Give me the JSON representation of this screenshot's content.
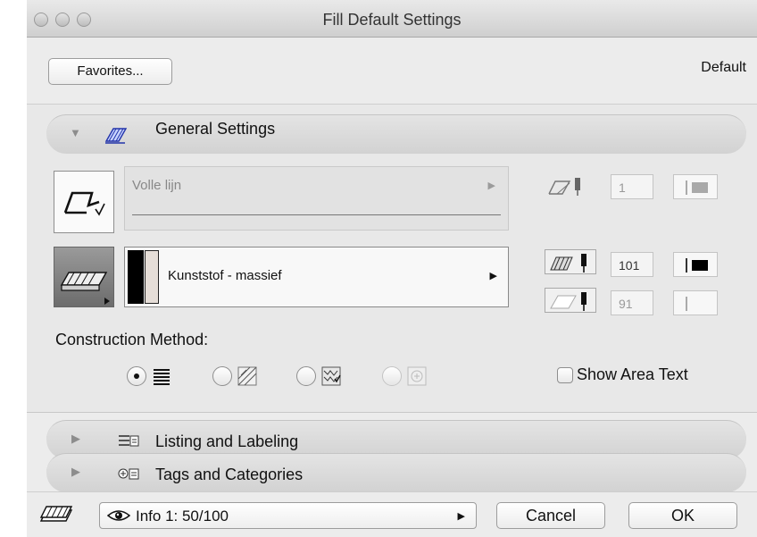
{
  "window": {
    "title": "Fill Default Settings"
  },
  "header": {
    "favorites_label": "Favorites...",
    "default_label": "Default"
  },
  "general": {
    "title": "General Settings",
    "line_type_value": "Volle lijn",
    "fill_type_value": "Kunststof - massief",
    "contour_pen_value": "1",
    "fill_pen_value": "101",
    "background_pen_value": "91",
    "construction_method_label": "Construction Method:",
    "construction_options": [
      {
        "icon": "solid-fill-icon",
        "selected": true,
        "enabled": true
      },
      {
        "icon": "hatch-fill-icon",
        "selected": false,
        "enabled": true
      },
      {
        "icon": "image-fill-icon",
        "selected": false,
        "enabled": true
      },
      {
        "icon": "gradient-fill-icon",
        "selected": false,
        "enabled": false
      }
    ],
    "show_area_text_label": "Show Area Text",
    "show_area_text_checked": false
  },
  "sections": [
    {
      "title": "Listing and Labeling",
      "icon": "listing-icon",
      "expanded": false
    },
    {
      "title": "Tags and Categories",
      "icon": "tags-icon",
      "expanded": false
    }
  ],
  "footer": {
    "layer_value": "Info 1: 50/100",
    "cancel_label": "Cancel",
    "ok_label": "OK"
  },
  "colors": {
    "window_bg": "#ececec",
    "section_bar": "#dadada",
    "fill_swatch": "#000000",
    "background_swatch": "#e6ded8"
  }
}
